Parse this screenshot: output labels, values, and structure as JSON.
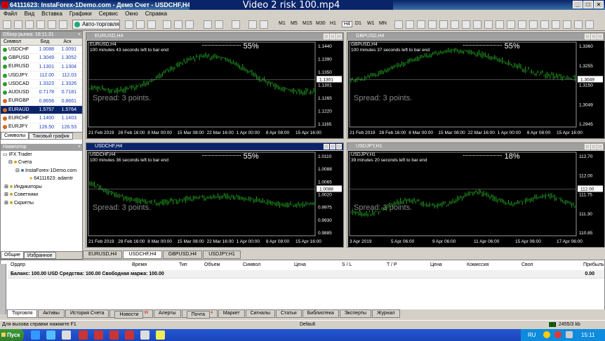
{
  "window": {
    "title": "64111623: InstaForex-1Demo.com - Демо Счет - USDCHF,H4",
    "video_overlay": "Video 2 risk 100.mp4"
  },
  "menu": [
    "Файл",
    "Вид",
    "Вставка",
    "Графики",
    "Сервис",
    "Окно",
    "Справка"
  ],
  "toolbar": {
    "autotrade": "Авто-торговля",
    "timeframes": [
      "M1",
      "M5",
      "M15",
      "M30",
      "H1",
      "H4",
      "D1",
      "W1",
      "MN"
    ]
  },
  "market_watch": {
    "title": "Обзор рынка: 18:11:31",
    "cols": [
      "Символ",
      "Бид",
      "Аск"
    ],
    "rows": [
      {
        "sym": "USDCHF",
        "bid": "1.0088",
        "ask": "1.0091",
        "color": "#2a9d2a"
      },
      {
        "sym": "GBPUSD",
        "bid": "1.3049",
        "ask": "1.3052",
        "color": "#2a9d2a"
      },
      {
        "sym": "EURUSD",
        "bid": "1.1301",
        "ask": "1.1304",
        "color": "#2a9d2a"
      },
      {
        "sym": "USDJPY",
        "bid": "112.00",
        "ask": "112.03",
        "color": "#2a9d2a"
      },
      {
        "sym": "USDCAD",
        "bid": "1.3323",
        "ask": "1.3326",
        "color": "#2a9d2a"
      },
      {
        "sym": "AUDUSD",
        "bid": "0.7178",
        "ask": "0.7181",
        "color": "#2a9d2a"
      },
      {
        "sym": "EURGBP",
        "bid": "0.8658",
        "ask": "0.8661",
        "color": "#d2691e"
      },
      {
        "sym": "EURAUD",
        "bid": "1.5757",
        "ask": "1.5764",
        "color": "#d2691e",
        "selected": true
      },
      {
        "sym": "EURCHF",
        "bid": "1.1400",
        "ask": "1.1403",
        "color": "#d2691e"
      },
      {
        "sym": "EURJPY",
        "bid": "126.50",
        "ask": "126.53",
        "color": "#d2691e"
      }
    ],
    "tabs": [
      "Символы",
      "Тиковый график"
    ]
  },
  "navigator": {
    "title": "Навигатор",
    "items": [
      "IFX Trader",
      "Счета",
      "InstaForex-1Demo.com",
      "64111623: adamtr",
      "Индикаторы",
      "Советники",
      "Скрипты"
    ],
    "tabs": [
      "Общие",
      "Избранное"
    ]
  },
  "charts": [
    {
      "id": "eurusd",
      "title": "EURUSD,H4",
      "info": "EURUSD,H4",
      "timer": "100 minutes 43 seconds left to bar end",
      "percent": "55%",
      "spread": "Spread: 3 points.",
      "price_tag": "1.1301",
      "yticks": [
        "1.1440",
        "1.1390",
        "1.1350",
        "1.1301",
        "1.1265",
        "1.1220",
        "1.1165"
      ],
      "xticks": [
        "21 Feb 2019",
        "28 Feb 16:00",
        "8 Mar 00:00",
        "15 Mar 08:00",
        "22 Mar 16:00",
        "1 Apr 00:00",
        "8 Apr 08:00",
        "15 Apr 16:00"
      ]
    },
    {
      "id": "gbpusd",
      "title": "GBPUSD,H4",
      "info": "GBPUSD,H4",
      "timer": "100 minutes 37 seconds left to bar end",
      "percent": "55%",
      "spread": "Spread: 3 points.",
      "price_tag": "1.3049",
      "yticks": [
        "1.3360",
        "1.3255",
        "1.3150",
        "1.3049",
        "1.2945"
      ],
      "xticks": [
        "21 Feb 2019",
        "28 Feb 16:00",
        "8 Mar 00:00",
        "15 Mar 08:00",
        "22 Mar 16:00",
        "1 Apr 00:00",
        "8 Apr 08:00",
        "15 Apr 16:00"
      ]
    },
    {
      "id": "usdchf",
      "title": "USDCHF,H4",
      "info": "USDCHF,H4",
      "timer": "100 minutes 36 seconds left to bar end",
      "percent": "55%",
      "spread": "Spread: 3 points.",
      "price_tag": "1.0088",
      "yticks": [
        "1.0110",
        "1.0088",
        "1.0065",
        "1.0020",
        "0.9975",
        "0.9930",
        "0.9885"
      ],
      "xticks": [
        "21 Feb 2019",
        "28 Feb 16:00",
        "8 Mar 00:00",
        "15 Mar 08:00",
        "22 Mar 16:00",
        "1 Apr 00:00",
        "8 Apr 08:00",
        "15 Apr 16:00"
      ]
    },
    {
      "id": "usdjpy",
      "title": "USDJPY,H1",
      "info": "USDJPY,H1",
      "timer": "39 minutes 20 seconds left to bar end",
      "percent": "18%",
      "spread": "Spread: 3 points.",
      "price_tag": "112.00",
      "yticks": [
        "112.70",
        "112.00",
        "111.75",
        "111.30",
        "110.85"
      ],
      "xticks": [
        "3 Apr 2019",
        "5 Apr 06:00",
        "9 Apr 06:00",
        "11 Apr 06:00",
        "15 Apr 06:00",
        "17 Apr 06:00"
      ]
    }
  ],
  "chart_tabs": [
    "EURUSD,H4",
    "USDCHF,H4",
    "GBPUSD,H4",
    "USDJPY,H1"
  ],
  "terminal": {
    "cols": [
      "Ордер",
      "Время",
      "Тип",
      "Объем",
      "Символ",
      "Цена",
      "S / L",
      "T / P",
      "Цена",
      "Комиссия",
      "Своп",
      "Прибыль"
    ],
    "balance": "Баланс: 100.00 USD  Средства: 100.00  Свободная маржа: 100.00",
    "profit": "0.00",
    "tabs": [
      "Торговля",
      "Активы",
      "История Счета",
      "Новости",
      "Алерты",
      "Почта",
      "Маркет",
      "Сигналы",
      "Статьи",
      "Библиотека",
      "Эксперты",
      "Журнал"
    ],
    "news_badge": "99",
    "mail_badge": "4"
  },
  "statusbar": {
    "help": "Для вызова справки нажмите F1",
    "profile": "Default",
    "traffic": "2455/3 kb"
  },
  "taskbar": {
    "start": "Пуск",
    "lang": "RU",
    "clock": "15:11"
  }
}
